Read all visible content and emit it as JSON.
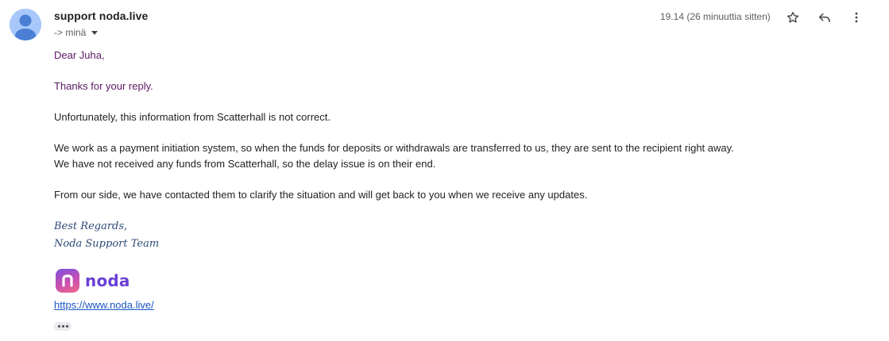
{
  "header": {
    "sender": "support noda.live",
    "recipient": "-> minä",
    "timestamp": "19.14 (26 minuuttia sitten)"
  },
  "body": {
    "greeting": "Dear Juha,",
    "thanks": "Thanks for your reply.",
    "para1": "Unfortunately, this information from Scatterhall is not correct.",
    "para2_line1": "We work as a payment initiation system, so when the funds for deposits or withdrawals are transferred to us, they are sent to the recipient right away.",
    "para2_line2": "We have not received any funds from Scatterhall, so the delay issue is on their end.",
    "para3": "From our side, we have contacted them to clarify the situation and will get back to you when we receive any updates.",
    "sig_line1": "Best Regards,",
    "sig_line2": "Noda Support Team"
  },
  "logo": {
    "text": "noda"
  },
  "link": {
    "text": "https://www.noda.live/"
  },
  "icons": {
    "avatar": "person-avatar-icon",
    "star": "star-icon",
    "reply": "reply-icon",
    "more": "more-vertical-icon",
    "expand": "ellipsis-icon"
  },
  "colors": {
    "avatar_bg": "#a8c7fa",
    "avatar_fg": "#4b7fd6",
    "greeting_text": "#5b1a63",
    "signature_text": "#2c4a78",
    "link": "#1a55c5",
    "logo_text": "#6a3fd6"
  }
}
